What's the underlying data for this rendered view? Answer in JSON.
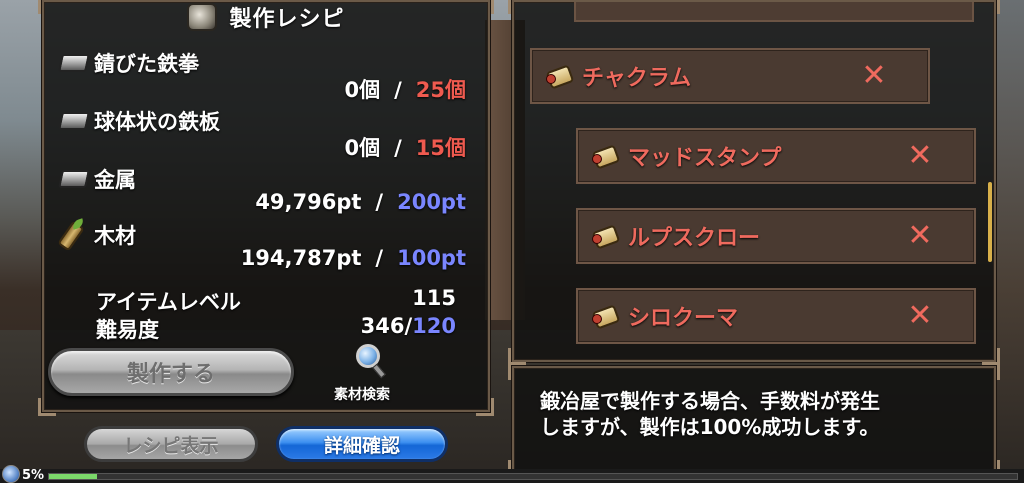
{
  "recipe": {
    "title": "製作レシピ",
    "materials": [
      {
        "icon": "iron-ingot-icon",
        "name": "錆びた鉄拳",
        "have": "0個",
        "need": "25個",
        "need_color": "#ef5a4f"
      },
      {
        "icon": "iron-ingot-icon",
        "name": "球体状の鉄板",
        "have": "0個",
        "need": "15個",
        "need_color": "#ef5a4f"
      },
      {
        "icon": "iron-ingot-icon",
        "name": "金属",
        "have": "49,796pt",
        "need": "200pt",
        "need_color": "#7a86ff"
      },
      {
        "icon": "wood-log-icon",
        "name": "木材",
        "have": "194,787pt",
        "need": "100pt",
        "need_color": "#7a86ff"
      }
    ],
    "separator": "/",
    "item_level_label": "アイテムレベル",
    "item_level_value": "115",
    "difficulty_label": "難易度",
    "difficulty_current": "346/",
    "difficulty_required": "120",
    "craft_button": "製作する",
    "search_label": "素材検索",
    "recipe_view_button": "レシピ表示",
    "detail_button": "詳細確認"
  },
  "list": {
    "items": [
      {
        "label": "チャクラム",
        "close": "✕"
      },
      {
        "label": "マッドスタンプ",
        "close": "✕"
      },
      {
        "label": "ルプスクロー",
        "close": "✕"
      },
      {
        "label": "シロクーマ",
        "close": "✕"
      }
    ]
  },
  "description": {
    "line1": "鍛冶屋で製作する場合、手数料が発生",
    "line2": "しますが、製作は100%成功します。"
  },
  "exp": {
    "percent_label": "5%",
    "percent": 0.05
  },
  "colors": {
    "accent_red": "#ef5a4f",
    "accent_blue": "#7a86ff",
    "panel_border": "#6b5a48"
  }
}
